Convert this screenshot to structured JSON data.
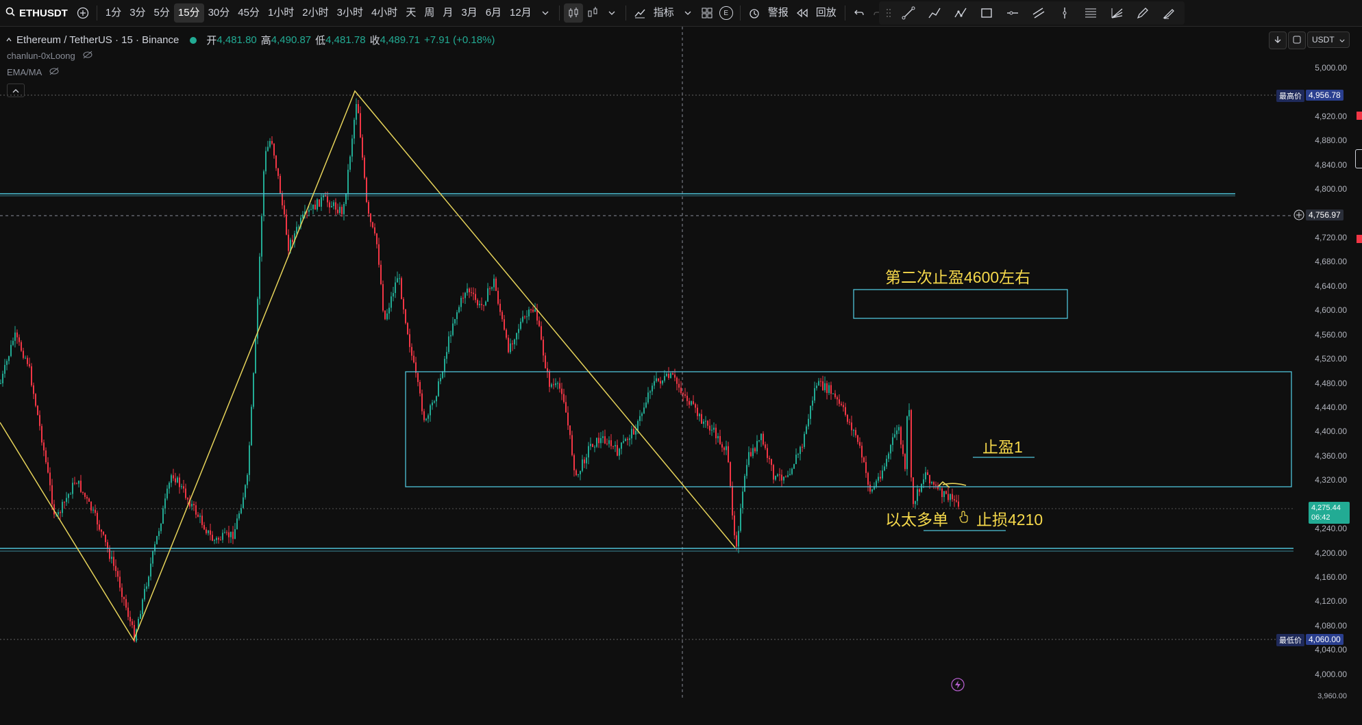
{
  "symbol": "ETHUSDT",
  "toolbar": {
    "timeframes": [
      "1分",
      "3分",
      "5分",
      "15分",
      "30分",
      "45分",
      "1小时",
      "2小时",
      "3小时",
      "4小时",
      "天",
      "周",
      "月",
      "3月",
      "6月",
      "12月"
    ],
    "active_timeframe": "15分",
    "indicators_label": "指标",
    "alert_label": "警报",
    "replay_label": "回放",
    "e_badge": "E"
  },
  "legend": {
    "title": "Ethereum / TetherUS · 15 · Binance",
    "open_label": "开",
    "open": "4,481.80",
    "high_label": "高",
    "high": "4,490.87",
    "low_label": "低",
    "low": "4,481.78",
    "close_label": "收",
    "close": "4,489.71",
    "change": "+7.91 (+0.18%)"
  },
  "indicators": [
    {
      "name": "chanlun-0xLoong"
    },
    {
      "name": "EMA/MA"
    }
  ],
  "currency": "USDT",
  "price_axis": {
    "ticks": [
      "5,000.00",
      "4,920.00",
      "4,880.00",
      "4,840.00",
      "4,800.00",
      "4,720.00",
      "4,680.00",
      "4,640.00",
      "4,600.00",
      "4,560.00",
      "4,520.00",
      "4,480.00",
      "4,440.00",
      "4,400.00",
      "4,360.00",
      "4,320.00",
      "4,240.00",
      "4,200.00",
      "4,160.00",
      "4,120.00",
      "4,080.00",
      "4,040.00",
      "4,000.00"
    ],
    "max_label": "最高价",
    "max_value": "4,956.78",
    "min_label": "最低价",
    "min_value": "4,060.00",
    "crosshair_value": "4,756.97",
    "last_price": "4,275.44",
    "countdown": "06:42",
    "bottom_partial": "3,960.00"
  },
  "annotations": {
    "tp2": "第二次止盈4600左右",
    "tp1": "止盈1",
    "entry": "以太多单",
    "stop": "止损4210"
  },
  "colors": {
    "up": "#22ab94",
    "down": "#f23645",
    "zone": "#4fc3d9",
    "trend": "#e6d35a",
    "annot": "#f5d84b"
  }
}
